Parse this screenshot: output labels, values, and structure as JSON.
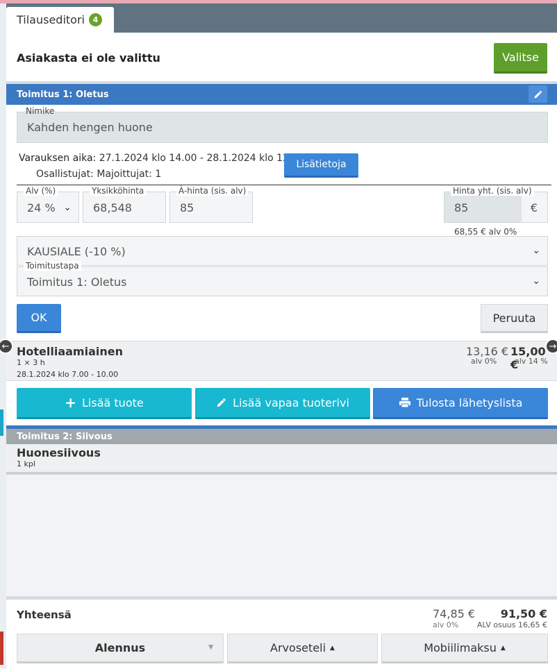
{
  "tab": {
    "title": "Tilauseditori",
    "badge": "4"
  },
  "customer": {
    "title": "Asiakasta ei ole valittu",
    "select_label": "Valitse"
  },
  "delivery1": {
    "title": "Toimitus 1: Oletus",
    "item_name": {
      "label": "Nimike",
      "value": "Kahden hengen huone"
    },
    "reservation_label": "Varauksen aika:",
    "reservation_value": "27.1.2024 klo 14.00 - 28.1.2024 klo 12.00",
    "participants_label": "Osallistujat:",
    "participants_value": "Majoittujat: 1",
    "more_info_label": "Lisätietoja",
    "vat": {
      "label": "Alv (%)",
      "value": "24 %"
    },
    "unit_price": {
      "label": "Yksikköhinta",
      "value": "68,548"
    },
    "each_price": {
      "label": "À-hinta (sis. alv)",
      "value": "85"
    },
    "total_price": {
      "label": "Hinta yht. (sis. alv)",
      "value": "85",
      "currency": "€",
      "sub": "68,55 € alv 0%"
    },
    "discount": {
      "value": "KAUSIALE (-10 %)"
    },
    "delivery_method": {
      "label": "Toimitustapa",
      "value": "Toimitus 1: Oletus"
    },
    "ok_label": "OK",
    "cancel_label": "Peruuta",
    "row": {
      "name": "Hotelliaamiainen",
      "qty": "1 × 3 h",
      "date": "28.1.2024 klo 7.00 - 10.00",
      "price_net": "13,16 €",
      "price_net_note": "alv 0%",
      "price_gross": "15,00 €",
      "price_gross_note": "alv 14 %"
    }
  },
  "actions": {
    "add_product": "Lisää tuote",
    "add_free_row": "Lisää vapaa tuoterivi",
    "print_list": "Tulosta lähetyslista"
  },
  "delivery2": {
    "title": "Toimitus 2: Siivous",
    "row": {
      "name": "Huonesiivous",
      "qty": "1 kpl"
    }
  },
  "totals": {
    "label": "Yhteensä",
    "net": "74,85 €",
    "net_note": "alv 0%",
    "gross": "91,50 €",
    "vat_note": "ALV osuus 16,65 €"
  },
  "footer": {
    "discount_label": "Alennus",
    "voucher_label": "Arvoseteli",
    "mobile_label": "Mobiilimaksu"
  },
  "colors": {
    "header_blue": "#3a78c2",
    "green": "#5e9f2b",
    "teal": "#18b8d1",
    "button_blue": "#3a86d8"
  }
}
